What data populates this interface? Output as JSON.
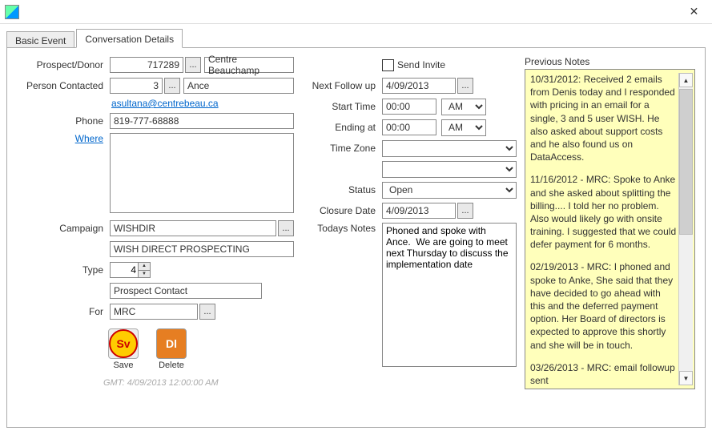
{
  "window": {
    "close_glyph": "✕"
  },
  "tabs": {
    "basic": "Basic Event",
    "details": "Conversation Details"
  },
  "left": {
    "prospect_label": "Prospect/Donor",
    "prospect_id": "717289",
    "prospect_name": "Centre Beauchamp",
    "contact_label": "Person Contacted",
    "contact_id": "3",
    "contact_name": "Ance",
    "email": "asultana@centrebeau.ca",
    "phone_label": "Phone",
    "phone": "819-777-68888",
    "where_label": "Where",
    "where_text": "",
    "campaign_label": "Campaign",
    "campaign_code": "WISHDIR",
    "campaign_name": "WISH DIRECT PROSPECTING",
    "type_label": "Type",
    "type_value": "4",
    "type_name": "Prospect Contact",
    "for_label": "For",
    "for_value": "MRC",
    "save_label": "Save",
    "save_icon_text": "Sv",
    "delete_label": "Delete",
    "delete_icon_text": "Dl",
    "gmt": "GMT: 4/09/2013 12:00:00 AM",
    "ellipsis": "..."
  },
  "mid": {
    "send_invite_label": "Send Invite",
    "followup_label": "Next Follow up",
    "followup": "4/09/2013",
    "start_label": "Start Time",
    "start_time": "00:00",
    "start_ampm": "AM",
    "end_label": "Ending at",
    "end_time": "00:00",
    "end_ampm": "AM",
    "tz_label": "Time Zone",
    "tz1": "",
    "tz2": "",
    "status_label": "Status",
    "status": "Open",
    "closure_label": "Closure Date",
    "closure": "4/09/2013",
    "notes_label": "Todays Notes",
    "notes": "Phoned and spoke with Ance.  We are going to meet next Thursday to discuss the implementation date",
    "ellipsis": "..."
  },
  "right": {
    "title": "Previous Notes",
    "entries": [
      "10/31/2012: Received 2 emails from Denis today and I responded with pricing in an email for a single, 3 and 5 user WISH.  He also asked about support costs and he also found us on DataAccess.",
      "11/16/2012 - MRC: Spoke to Anke and she asked about splitting the billing.... I told her no problem.  Also would likely go with onsite training.   I suggested that we could defer payment for 6 months.",
      "02/19/2013 - MRC: I phoned and spoke to Anke,  She said that they have decided to go ahead with this and the deferred payment option.  Her Board of directors is expected to approve this shortly and she will be in touch.",
      "03/26/2013 - MRC: email followup sent"
    ],
    "sb_up": "▲",
    "sb_down": "▼"
  }
}
